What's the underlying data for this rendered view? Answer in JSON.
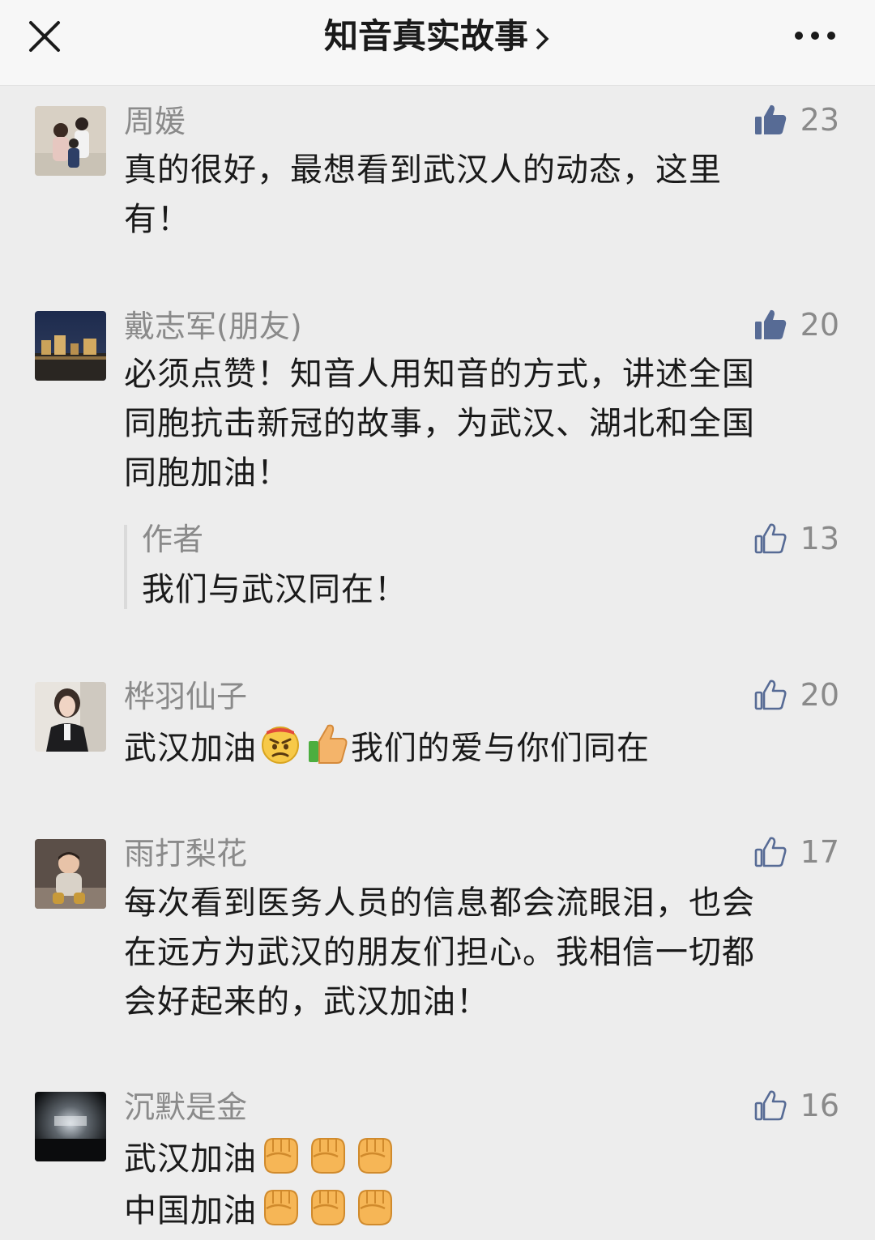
{
  "header": {
    "title": "知音真实故事",
    "chevron": "›",
    "close_icon": "close-icon",
    "more_icon": "more-icon"
  },
  "comments": [
    {
      "name": "周媛",
      "likes": "23",
      "liked": true,
      "text_lines": [
        "真的很好，最想看到武汉人的动态，这里",
        "有！"
      ]
    },
    {
      "name": "戴志军(朋友)",
      "likes": "20",
      "liked": true,
      "text_lines": [
        "必须点赞！知音人用知音的方式，讲述全国",
        "同胞抗击新冠的故事，为武汉、湖北和全国",
        "同胞加油！"
      ],
      "reply": {
        "name": "作者",
        "likes": "13",
        "text": "我们与武汉同在！"
      }
    },
    {
      "name": "桦羽仙子",
      "likes": "20",
      "liked": false,
      "text_before": "武汉加油",
      "text_after": "我们的爱与你们同在",
      "emoji": [
        "angry-face-icon",
        "thumbs-up-icon"
      ]
    },
    {
      "name": "雨打梨花",
      "likes": "17",
      "liked": false,
      "text_lines": [
        "每次看到医务人员的信息都会流眼泪，也会",
        "在远方为武汉的朋友们担心。我相信一切都",
        "会好起来的，武汉加油！"
      ]
    },
    {
      "name": "沉默是金",
      "likes": "16",
      "liked": false,
      "text_lines": [
        "武汉加油",
        "中国加油"
      ],
      "emoji": [
        "fist-icon",
        "fist-icon",
        "fist-icon"
      ]
    }
  ],
  "colors": {
    "accent_like": "#576b95",
    "name_gray": "#8a8a8a",
    "text": "#1a1a1a",
    "background": "#ededed"
  }
}
